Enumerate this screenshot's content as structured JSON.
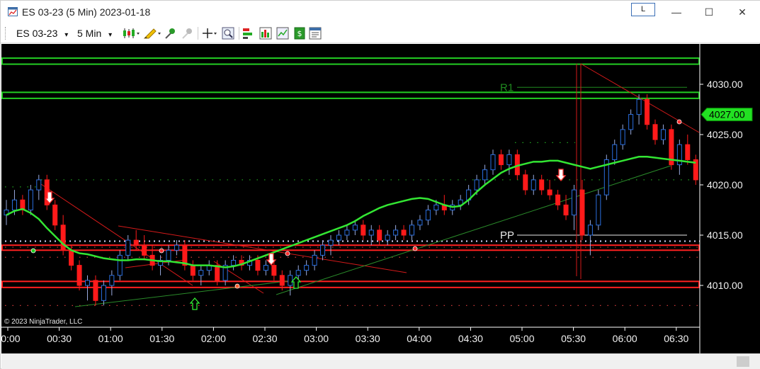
{
  "window": {
    "title": "ES 03-23 (5 Min)  2023-01-18",
    "link_label": "L",
    "minimize_glyph": "—",
    "maximize_glyph": "☐",
    "close_glyph": "✕"
  },
  "toolbar": {
    "instrument": "ES 03-23",
    "interval": "5 Min",
    "dropdown_glyph": "▾",
    "icons": [
      "bar-type-icon",
      "drawing-tool-icon",
      "pin-icon",
      "pin-disabled-icon",
      "crosshair-icon",
      "zoom-icon",
      "strategies-icon",
      "indicators-icon",
      "chart-properties-icon",
      "trade-icon",
      "data-box-icon"
    ]
  },
  "chart": {
    "copyright": "© 2023 NinjaTrader, LLC",
    "colors": {
      "background": "#000000",
      "up": "#00e000",
      "down": "#ff1a1a",
      "ma": "#33e633",
      "resistance": "#22cc22",
      "support": "#ff2020",
      "price_label": "#22e022"
    },
    "y_labels": [
      "4030.00",
      "4025.00",
      "4020.00",
      "4015.00",
      "4010.00"
    ],
    "y_values": [
      4030,
      4025,
      4020,
      4015,
      4010
    ],
    "x_labels": [
      "00:00",
      "00:30",
      "01:00",
      "01:30",
      "02:00",
      "02:30",
      "03:00",
      "03:30",
      "04:00",
      "04:30",
      "05:00",
      "05:30",
      "06:00",
      "06:30"
    ],
    "current_price": "4027.00",
    "current_price_value": 4027.0,
    "pivot_labels": {
      "r1": "R1",
      "pp": "PP"
    },
    "pivot_values": {
      "r1": 4029.7,
      "pp": 4015.0
    },
    "zones": [
      {
        "kind": "resistance",
        "top": 4032.6,
        "bottom": 4032.0
      },
      {
        "kind": "resistance",
        "top": 4029.2,
        "bottom": 4028.6
      },
      {
        "kind": "support",
        "top": 4014.0,
        "bottom": 4013.5
      },
      {
        "kind": "support",
        "top": 4010.4,
        "bottom": 4009.8
      }
    ],
    "candles": [
      [
        4017.0,
        4018.5,
        4016.0,
        4017.5
      ],
      [
        4017.5,
        4019.5,
        4017.0,
        4018.5
      ],
      [
        4018.5,
        4019.0,
        4017.0,
        4017.5
      ],
      [
        4017.5,
        4020.0,
        4017.0,
        4019.5
      ],
      [
        4019.5,
        4021.0,
        4018.5,
        4020.5
      ],
      [
        4020.5,
        4021.0,
        4017.5,
        4018.0
      ],
      [
        4018.0,
        4018.5,
        4015.5,
        4016.0
      ],
      [
        4016.0,
        4017.0,
        4013.0,
        4013.5
      ],
      [
        4013.5,
        4014.0,
        4011.5,
        4012.0
      ],
      [
        4012.0,
        4012.5,
        4009.5,
        4010.0
      ],
      [
        4010.0,
        4011.0,
        4008.5,
        4010.5
      ],
      [
        4010.5,
        4011.0,
        4008.0,
        4008.5
      ],
      [
        4008.5,
        4010.5,
        4008.0,
        4010.0
      ],
      [
        4010.0,
        4011.5,
        4009.0,
        4011.0
      ],
      [
        4011.0,
        4013.5,
        4010.5,
        4013.0
      ],
      [
        4013.0,
        4015.0,
        4012.5,
        4014.5
      ],
      [
        4014.5,
        4015.5,
        4013.5,
        4014.0
      ],
      [
        4014.0,
        4015.0,
        4012.5,
        4013.0
      ],
      [
        4013.0,
        4014.0,
        4011.5,
        4012.0
      ],
      [
        4012.0,
        4013.0,
        4011.0,
        4012.5
      ],
      [
        4012.5,
        4014.0,
        4012.0,
        4013.5
      ],
      [
        4013.5,
        4014.5,
        4013.0,
        4014.0
      ],
      [
        4014.0,
        4014.5,
        4011.5,
        4012.0
      ],
      [
        4012.0,
        4012.5,
        4010.5,
        4011.0
      ],
      [
        4011.0,
        4012.0,
        4010.0,
        4011.5
      ],
      [
        4011.5,
        4012.5,
        4011.0,
        4012.0
      ],
      [
        4012.0,
        4012.5,
        4010.0,
        4010.5
      ],
      [
        4010.5,
        4012.5,
        4010.0,
        4012.0
      ],
      [
        4012.0,
        4013.0,
        4011.5,
        4012.5
      ],
      [
        4012.5,
        4013.0,
        4011.5,
        4012.0
      ],
      [
        4012.0,
        4013.0,
        4011.5,
        4012.5
      ],
      [
        4012.5,
        4013.0,
        4011.0,
        4011.5
      ],
      [
        4011.5,
        4012.5,
        4011.0,
        4012.0
      ],
      [
        4012.0,
        4012.5,
        4010.5,
        4011.0
      ],
      [
        4011.0,
        4011.5,
        4009.5,
        4010.0
      ],
      [
        4010.0,
        4011.5,
        4009.0,
        4011.0
      ],
      [
        4011.0,
        4012.0,
        4010.5,
        4011.5
      ],
      [
        4011.5,
        4012.5,
        4011.0,
        4012.0
      ],
      [
        4012.0,
        4013.5,
        4011.5,
        4013.0
      ],
      [
        4013.0,
        4014.5,
        4012.5,
        4014.0
      ],
      [
        4014.0,
        4015.0,
        4013.0,
        4014.5
      ],
      [
        4014.5,
        4015.5,
        4014.0,
        4015.0
      ],
      [
        4015.0,
        4016.0,
        4014.5,
        4015.5
      ],
      [
        4015.5,
        4016.5,
        4015.0,
        4016.0
      ],
      [
        4016.0,
        4016.5,
        4014.5,
        4015.0
      ],
      [
        4015.0,
        4016.0,
        4014.0,
        4015.5
      ],
      [
        4015.5,
        4016.0,
        4014.0,
        4014.5
      ],
      [
        4014.5,
        4015.5,
        4014.0,
        4015.0
      ],
      [
        4015.0,
        4016.0,
        4014.5,
        4015.5
      ],
      [
        4015.5,
        4016.0,
        4014.5,
        4015.0
      ],
      [
        4015.0,
        4016.5,
        4014.5,
        4016.0
      ],
      [
        4016.0,
        4017.0,
        4015.5,
        4016.5
      ],
      [
        4016.5,
        4018.0,
        4016.0,
        4017.5
      ],
      [
        4017.5,
        4018.5,
        4017.0,
        4018.0
      ],
      [
        4018.0,
        4019.0,
        4017.0,
        4017.5
      ],
      [
        4017.5,
        4018.5,
        4017.0,
        4018.0
      ],
      [
        4018.0,
        4019.0,
        4017.5,
        4018.5
      ],
      [
        4018.5,
        4020.0,
        4018.0,
        4019.5
      ],
      [
        4019.5,
        4021.0,
        4019.0,
        4020.5
      ],
      [
        4020.5,
        4022.0,
        4020.0,
        4021.5
      ],
      [
        4021.5,
        4023.5,
        4021.0,
        4023.0
      ],
      [
        4023.0,
        4023.5,
        4021.5,
        4022.0
      ],
      [
        4022.0,
        4023.5,
        4021.0,
        4023.0
      ],
      [
        4023.0,
        4023.5,
        4020.5,
        4021.0
      ],
      [
        4021.0,
        4021.5,
        4019.0,
        4019.5
      ],
      [
        4019.5,
        4021.0,
        4019.0,
        4020.5
      ],
      [
        4020.5,
        4021.0,
        4019.0,
        4019.5
      ],
      [
        4019.5,
        4020.5,
        4018.5,
        4019.0
      ],
      [
        4019.0,
        4019.5,
        4017.5,
        4018.0
      ],
      [
        4018.0,
        4019.0,
        4016.5,
        4017.0
      ],
      [
        4017.0,
        4020.0,
        4015.5,
        4019.5
      ],
      [
        4019.5,
        4020.5,
        4014.5,
        4015.0
      ],
      [
        4015.0,
        4016.5,
        4013.0,
        4016.0
      ],
      [
        4016.0,
        4019.5,
        4015.5,
        4019.0
      ],
      [
        4019.0,
        4023.0,
        4018.5,
        4022.5
      ],
      [
        4022.5,
        4024.5,
        4022.0,
        4024.0
      ],
      [
        4024.0,
        4026.0,
        4023.5,
        4025.5
      ],
      [
        4025.5,
        4027.5,
        4025.0,
        4027.0
      ],
      [
        4027.0,
        4029.0,
        4026.0,
        4028.5
      ],
      [
        4028.5,
        4029.0,
        4025.5,
        4026.0
      ],
      [
        4026.0,
        4026.5,
        4024.0,
        4024.5
      ],
      [
        4024.5,
        4026.0,
        4024.0,
        4025.5
      ],
      [
        4025.5,
        4026.0,
        4021.5,
        4022.0
      ],
      [
        4022.0,
        4024.5,
        4021.0,
        4024.0
      ],
      [
        4024.0,
        4025.0,
        4022.0,
        4022.5
      ],
      [
        4022.5,
        4023.0,
        4020.0,
        4020.5
      ],
      [
        4020.5,
        4027.5,
        4019.5,
        4027.0
      ]
    ],
    "ma": [
      4017.0,
      4017.4,
      4017.6,
      4017.2,
      4016.6,
      4015.7,
      4014.9,
      4014.1,
      4013.5,
      4013.2,
      4013.1,
      4012.9,
      4012.7,
      4012.6,
      4012.5,
      4012.5,
      4012.6,
      4012.6,
      4012.5,
      4012.4,
      4012.4,
      4012.3,
      4012.2,
      4012.0,
      4012.0,
      4012.0,
      4011.9,
      4011.8,
      4011.9,
      4012.1,
      4012.4,
      4012.7,
      4013.0,
      4013.3,
      4013.6,
      4013.9,
      4014.2,
      4014.5,
      4014.8,
      4015.1,
      4015.4,
      4015.7,
      4016.0,
      4016.4,
      4016.9,
      4017.3,
      4017.7,
      4018.0,
      4018.2,
      4018.4,
      4018.6,
      4018.7,
      4018.6,
      4018.3,
      4018.0,
      4017.8,
      4017.9,
      4018.5,
      4019.3,
      4020.0,
      4020.6,
      4021.2,
      4021.6,
      4021.9,
      4022.1,
      4022.3,
      4022.3,
      4022.4,
      4022.4,
      4022.2,
      4022.0,
      4021.8,
      4021.6,
      4021.8,
      4022.0,
      4022.2,
      4022.4,
      4022.6,
      4022.8,
      4022.8,
      4022.7,
      4022.6,
      4022.5,
      4022.4,
      4022.3,
      4022.2,
      4022.3
    ]
  }
}
